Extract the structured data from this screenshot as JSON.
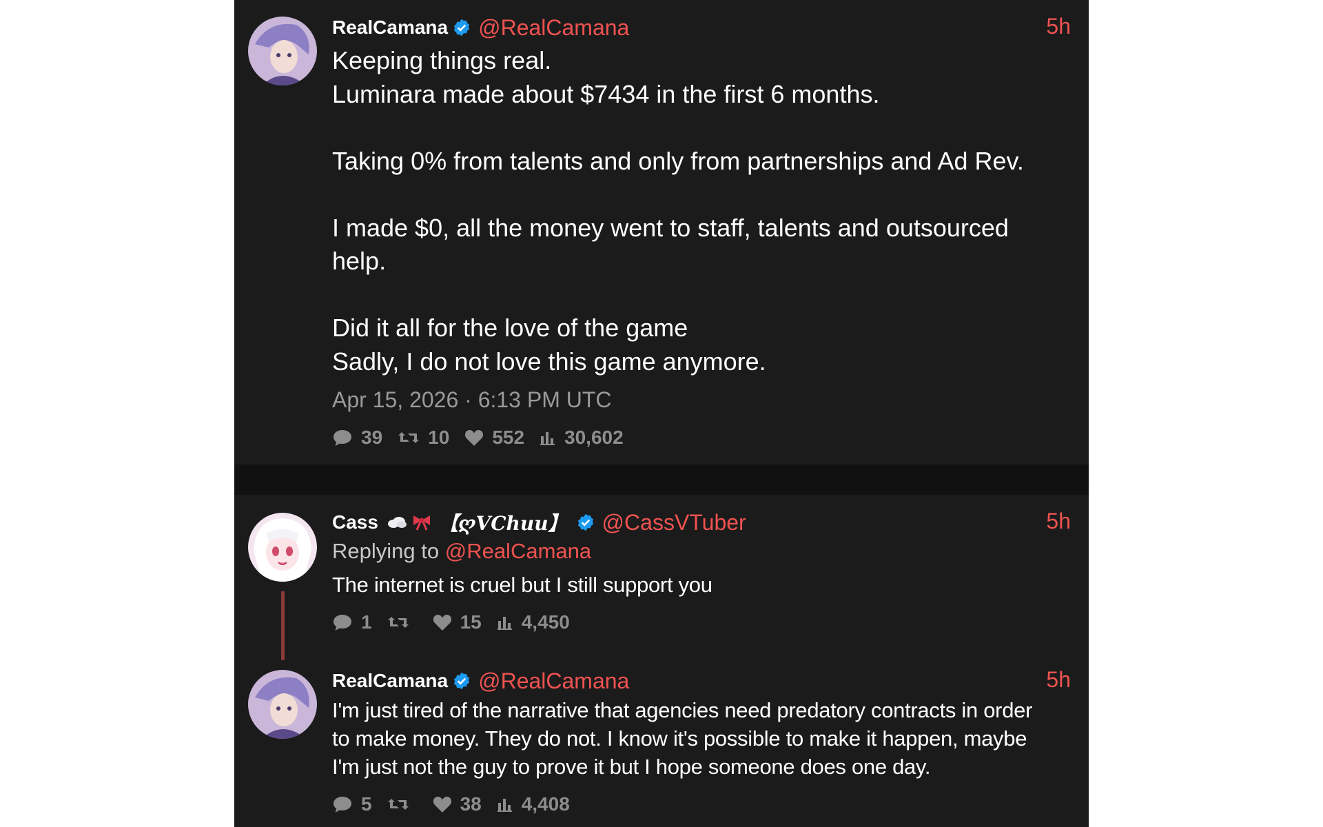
{
  "tweets": [
    {
      "author": "RealCamana",
      "handle": "@RealCamana",
      "time": "5h",
      "text": "Keeping things real.\nLuminara made about $7434 in the first 6 months.\n\nTaking 0% from talents and only from partnerships and Ad Rev.\n\nI made $0, all the money went to staff, talents and outsourced\nhelp.\n\nDid it all for the love of the game\nSadly, I do not love this game anymore.",
      "date": "Apr 15, 2026 · 6:13 PM UTC",
      "stats": {
        "replies": "39",
        "retweets": "10",
        "likes": "552",
        "views": "30,602"
      }
    },
    {
      "author": "Cass",
      "author_tag": "【ღVChuu】",
      "handle": "@CassVTuber",
      "time": "5h",
      "replying_prefix": "Replying to",
      "replying_handle": "@RealCamana",
      "text": "The internet is cruel but I still support you",
      "stats": {
        "replies": "1",
        "retweets": "",
        "likes": "15",
        "views": "4,450"
      }
    },
    {
      "author": "RealCamana",
      "handle": "@RealCamana",
      "time": "5h",
      "text": "I'm just tired of the narrative that agencies need predatory contracts in order\nto make money. They do not. I know it's possible to make it happen, maybe\nI'm just not the guy to prove it but I hope someone does one day.",
      "stats": {
        "replies": "5",
        "retweets": "",
        "likes": "38",
        "views": "4,408"
      }
    }
  ],
  "colors": {
    "background": "#1b1b1c",
    "accent": "#ef5350",
    "verified": "#1d9bf0",
    "muted": "#8d8d8d"
  },
  "icons": [
    "verified-badge-icon",
    "reply-icon",
    "retweet-icon",
    "like-icon",
    "views-icon",
    "cloud-emoji-icon",
    "ribbon-emoji-icon"
  ]
}
